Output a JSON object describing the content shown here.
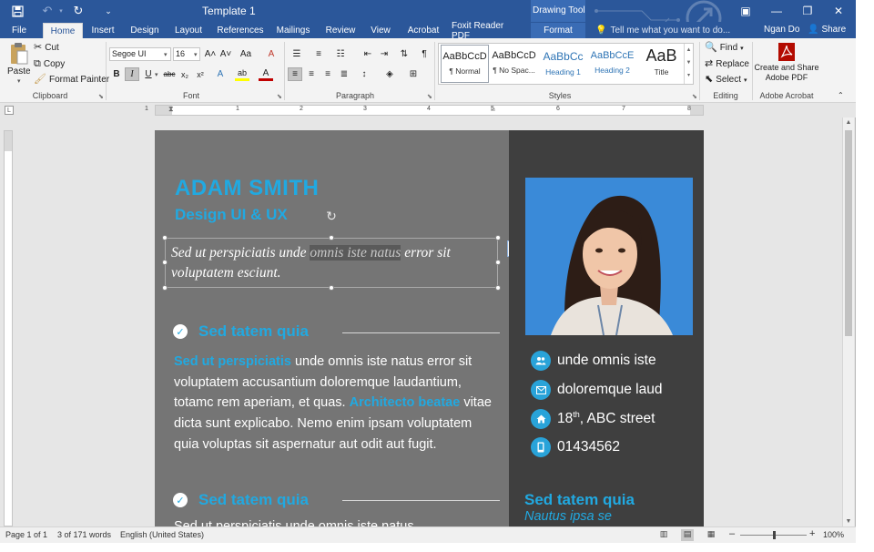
{
  "titlebar": {
    "title": "Template 1",
    "drawing_tools": "Drawing Tools",
    "save_icon": "💾",
    "undo_icon": "↶",
    "redo_icon": "↻",
    "qat_more": "⌄",
    "ribbon_display_icon": "▣",
    "minimize": "—",
    "restore": "❐",
    "close": "✕"
  },
  "tabs": {
    "file": "File",
    "home": "Home",
    "insert": "Insert",
    "design": "Design",
    "layout": "Layout",
    "references": "References",
    "mailings": "Mailings",
    "review": "Review",
    "view": "View",
    "acrobat": "Acrobat",
    "foxit": "Foxit Reader PDF",
    "format": "Format",
    "tellme": "Tell me what you want to do...",
    "user": "Ngan Do",
    "share": "Share"
  },
  "clipboard": {
    "paste": "Paste",
    "cut": "Cut",
    "copy": "Copy",
    "format_painter": "Format Painter",
    "label": "Clipboard"
  },
  "font": {
    "family": "Segoe UI",
    "size": "16",
    "grow": "A˄",
    "shrink": "A˅",
    "case": "Aa",
    "clear": "A",
    "bold": "B",
    "italic": "I",
    "underline": "U",
    "strike": "abc",
    "subscript": "x₂",
    "superscript": "x²",
    "effects": "A",
    "highlight": "ab",
    "color": "A",
    "label": "Font"
  },
  "paragraph": {
    "label": "Paragraph",
    "pilcrow": "¶"
  },
  "styles": {
    "label": "Styles",
    "items": [
      {
        "sample": "AaBbCcD",
        "name": "¶ Normal"
      },
      {
        "sample": "AaBbCcD",
        "name": "¶ No Spac..."
      },
      {
        "sample": "AaBbCc",
        "name": "Heading 1"
      },
      {
        "sample": "AaBbCcE",
        "name": "Heading 2"
      },
      {
        "sample": "AaB",
        "name": "Title"
      }
    ]
  },
  "editing": {
    "find": "Find",
    "replace": "Replace",
    "select": "Select",
    "label": "Editing"
  },
  "acrobat": {
    "create_line1": "Create and Share",
    "create_line2": "Adobe PDF",
    "label": "Adobe Acrobat"
  },
  "ruler": {
    "corner": "L",
    "numbers": [
      "1",
      "1",
      "2",
      "3",
      "4",
      "5",
      "6",
      "7",
      "8"
    ]
  },
  "resume": {
    "name": "ADAM SMITH",
    "role": "Design UI & UX",
    "quote_before": "Sed ut perspiciatis unde ",
    "quote_highlight": "omnis iste natus",
    "quote_after": " error sit voluptatem esciunt.",
    "section1_title": "Sed tatem quia",
    "body_acc1": "Sed ut perspiciatis",
    "body_part1": " unde omnis iste natus error sit voluptatem accusantium doloremque laudantium, totamc rem aperiam, et quas. ",
    "body_acc2": "Architecto beatae",
    "body_part2": " vitae dicta sunt explicabo. Nemo enim ipsam voluptatem quia voluptas sit aspernatur aut odit aut fugit.",
    "section2_title": "Sed tatem quia",
    "body2": "Sed ut perspiciatis unde omnis iste natus",
    "contacts": [
      {
        "icon": "people-icon",
        "text": "unde omnis iste"
      },
      {
        "icon": "mail-icon",
        "text": "doloremque laud"
      },
      {
        "icon": "home-icon",
        "text_before": "18",
        "sup": "th",
        "text_after": ", ABC street"
      },
      {
        "icon": "phone-icon",
        "text": "01434562"
      }
    ],
    "right_title": "Sed tatem quia",
    "right_sub": "Nautus ipsa se"
  },
  "statusbar": {
    "page": "Page 1 of 1",
    "words": "3 of 171 words",
    "language": "English (United States)",
    "zoom_minus": "–",
    "zoom_plus": "+",
    "zoom": "100%",
    "zoom_level_fraction": 0.5
  },
  "colors": {
    "accent": "#21a9e1",
    "word_blue": "#2b579a",
    "left_panel": "#757575",
    "right_panel": "#3f3f3f"
  }
}
